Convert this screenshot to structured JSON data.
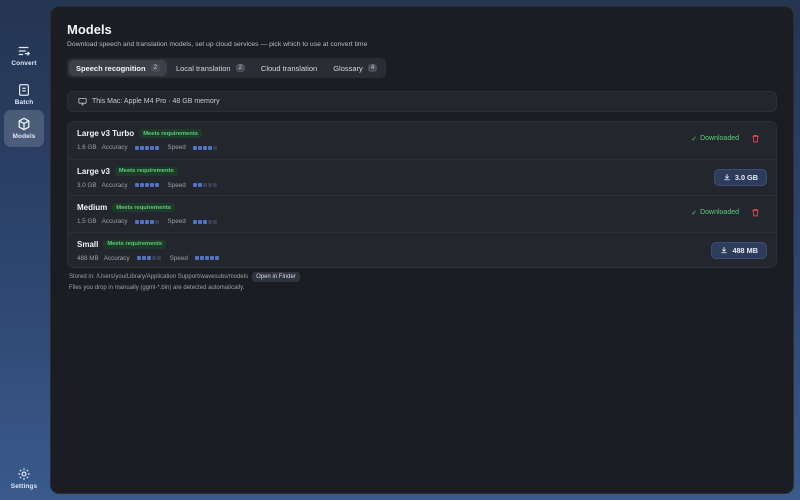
{
  "sidebar": {
    "items": [
      {
        "label": "Convert",
        "icon": "convert-icon"
      },
      {
        "label": "Batch",
        "icon": "batch-icon"
      },
      {
        "label": "Models",
        "icon": "cube-icon",
        "active": true
      },
      {
        "label": "Settings",
        "icon": "gear-icon"
      }
    ]
  },
  "header": {
    "title": "Models",
    "subtitle": "Download speech and translation models, set up cloud services — pick which to use at convert time"
  },
  "tabs": [
    {
      "label": "Speech recognition",
      "count": "2",
      "active": true
    },
    {
      "label": "Local translation",
      "count": "2"
    },
    {
      "label": "Cloud translation",
      "count": ""
    },
    {
      "label": "Glossary",
      "count": "4"
    }
  ],
  "machine": {
    "text": "This Mac: Apple M4 Pro · 48 GB memory",
    "icon": "monitor-icon"
  },
  "labels": {
    "accuracy": "Accuracy",
    "speed": "Speed",
    "downloaded": "Downloaded"
  },
  "models": [
    {
      "name": "Large v3 Turbo",
      "badge": "Meets requirements",
      "size": "1.6 GB",
      "accuracy": 5,
      "speed": 4,
      "status": "downloaded"
    },
    {
      "name": "Large v3",
      "badge": "Meets requirements",
      "size": "3.0 GB",
      "accuracy": 5,
      "speed": 2,
      "status": "download",
      "button": "3.0 GB"
    },
    {
      "name": "Medium",
      "badge": "Meets requirements",
      "size": "1.5 GB",
      "accuracy": 4,
      "speed": 3,
      "status": "downloaded"
    },
    {
      "name": "Small",
      "badge": "Meets requirements",
      "size": "488 MB",
      "accuracy": 3,
      "speed": 5,
      "status": "download",
      "button": "488 MB"
    }
  ],
  "footer": {
    "stored": "Stored in: /Users/you/Library/Application Support/wavesubs/models",
    "open_finder": "Open in Finder",
    "note": "Files you drop in manually (ggml-*.bin) are detected automatically."
  },
  "colors": {
    "accent_green": "#5ad07a",
    "danger": "#e5484d",
    "rating_on": "#5273c2"
  }
}
